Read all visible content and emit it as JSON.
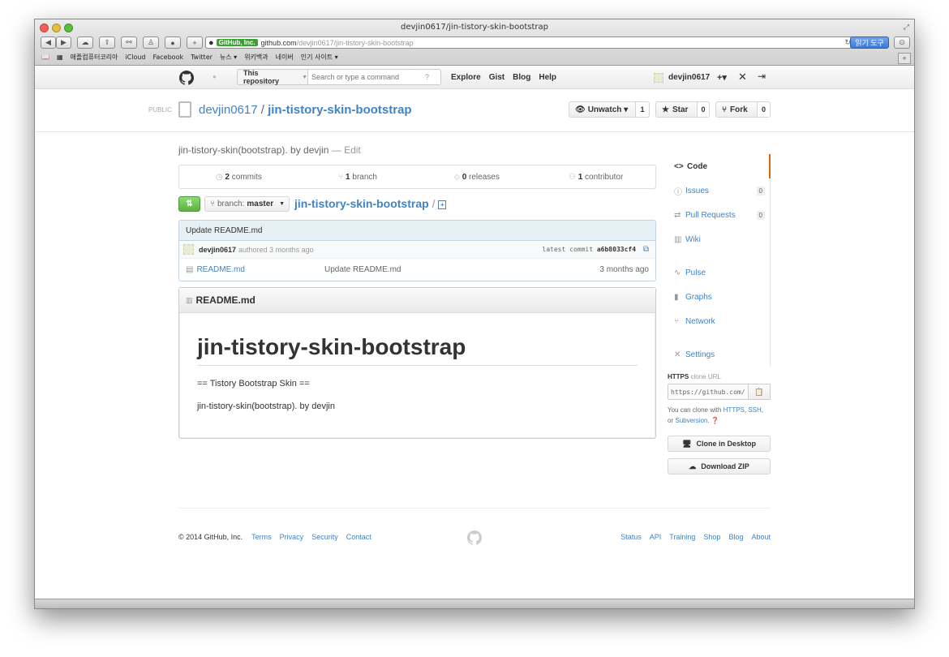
{
  "browser": {
    "window_title": "devjin0617/jin-tistory-skin-bootstrap",
    "ev_badge": "GitHub, Inc.",
    "url_host": "github.com",
    "url_path": "/devjin0617/jin-tistory-skin-bootstrap",
    "reader_label": "읽기 도구",
    "bookmarks": [
      "애플컴퓨터코리아",
      "iCloud",
      "Facebook",
      "Twitter",
      "뉴스 ▾",
      "위키백과",
      "네이버",
      "인기 사이트 ▾"
    ]
  },
  "header": {
    "scope_label": "This repository",
    "search_placeholder": "Search or type a command",
    "nav": [
      "Explore",
      "Gist",
      "Blog",
      "Help"
    ],
    "username": "devjin0617",
    "plus_label": "+▾"
  },
  "repo": {
    "visibility": "PUBLIC",
    "owner": "devjin0617",
    "separator": "/",
    "name": "jin-tistory-skin-bootstrap",
    "unwatch_label": "Unwatch ▾",
    "unwatch_count": "1",
    "star_label": "Star",
    "star_count": "0",
    "fork_label": "Fork",
    "fork_count": "0"
  },
  "main": {
    "description": "jin-tistory-skin(bootstrap). by devjin",
    "edit_label": "— Edit",
    "stats": [
      {
        "count": "2",
        "label": "commits"
      },
      {
        "count": "1",
        "label": "branch"
      },
      {
        "count": "0",
        "label": "releases"
      },
      {
        "count": "1",
        "label": "contributor"
      }
    ],
    "branch_prefix": "branch:",
    "branch_name": "master",
    "breadcrumb": "jin-tistory-skin-bootstrap",
    "breadcrumb_sep": "/",
    "commit": {
      "message": "Update README.md",
      "author": "devjin0617",
      "when": "authored 3 months ago",
      "latest_label": "latest commit",
      "sha": "a6b8033cf4"
    },
    "files": [
      {
        "name": "README.md",
        "message": "Update README.md",
        "age": "3 months ago"
      }
    ],
    "readme": {
      "title": "README.md",
      "h1": "jin-tistory-skin-bootstrap",
      "p1": "== Tistory Bootstrap Skin ==",
      "p2": "jin-tistory-skin(bootstrap). by devjin"
    }
  },
  "sidebar": {
    "code": "Code",
    "issues": "Issues",
    "issues_count": "0",
    "pulls": "Pull Requests",
    "pulls_count": "0",
    "wiki": "Wiki",
    "pulse": "Pulse",
    "graphs": "Graphs",
    "network": "Network",
    "settings": "Settings",
    "clone_protocol": "HTTPS",
    "clone_suffix": "clone URL",
    "clone_value": "https://github.com/",
    "clone_help_1": "You can clone with",
    "clone_https": "HTTPS",
    "clone_ssh": "SSH",
    "clone_help_2": ", or",
    "clone_svn": "Subversion",
    "clone_help_3": ".",
    "desktop_btn": "Clone in Desktop",
    "zip_btn": "Download ZIP"
  },
  "footer": {
    "copyright": "© 2014 GitHub, Inc.",
    "left_links": [
      "Terms",
      "Privacy",
      "Security",
      "Contact"
    ],
    "right_links": [
      "Status",
      "API",
      "Training",
      "Shop",
      "Blog",
      "About"
    ]
  },
  "colors": {
    "link": "#4183c4",
    "code_tab_accent": "#d26911",
    "clone_button": "#60b044",
    "commit_bar": "#e6f1f6"
  }
}
